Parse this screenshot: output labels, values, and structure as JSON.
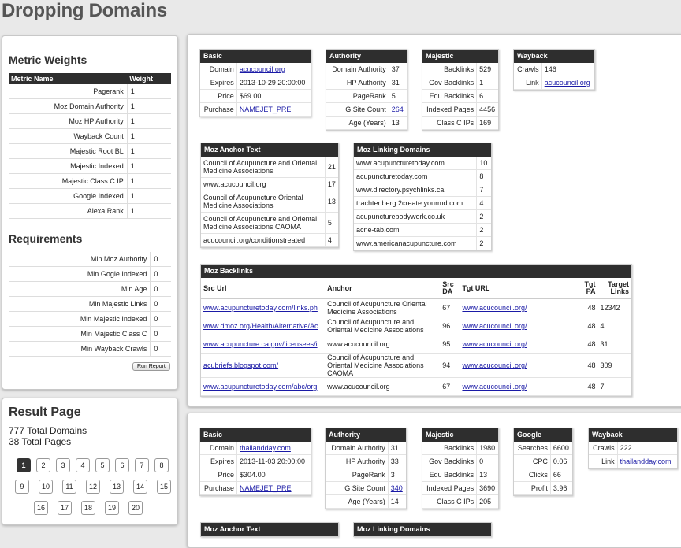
{
  "page_title": "Dropping Domains",
  "metric_weights": {
    "title": "Metric Weights",
    "col_name": "Metric Name",
    "col_weight": "Weight",
    "rows": [
      {
        "name": "Pagerank",
        "weight": "1"
      },
      {
        "name": "Moz Domain Authority",
        "weight": "1"
      },
      {
        "name": "Moz HP Authority",
        "weight": "1"
      },
      {
        "name": "Wayback Count",
        "weight": "1"
      },
      {
        "name": "Majestic Root BL",
        "weight": "1"
      },
      {
        "name": "Majestic Indexed",
        "weight": "1"
      },
      {
        "name": "Majestic Class C IP",
        "weight": "1"
      },
      {
        "name": "Google Indexed",
        "weight": "1"
      },
      {
        "name": "Alexa Rank",
        "weight": "1"
      }
    ]
  },
  "requirements": {
    "title": "Requirements",
    "rows": [
      {
        "name": "Min Moz Authority",
        "value": "0"
      },
      {
        "name": "Min Gogle Indexed",
        "value": "0"
      },
      {
        "name": "Min Age",
        "value": "0"
      },
      {
        "name": "Min Majestic Links",
        "value": "0"
      },
      {
        "name": "Min Majestic Indexed",
        "value": "0"
      },
      {
        "name": "Min Majestic Class C",
        "value": "0"
      },
      {
        "name": "Min Wayback Crawls",
        "value": "0"
      }
    ],
    "run_label": "Run Report"
  },
  "result_page": {
    "title": "Result Page",
    "total_domains": "777 Total Domains",
    "total_pages": "38 Total Pages",
    "pages": [
      "1",
      "2",
      "3",
      "4",
      "5",
      "6",
      "7",
      "8",
      "9",
      "10",
      "11",
      "12",
      "13",
      "14",
      "15",
      "16",
      "17",
      "18",
      "19",
      "20"
    ],
    "active": "1"
  },
  "results": [
    {
      "basic": {
        "title": "Basic",
        "rows": [
          [
            "Domain",
            "acucouncil.org"
          ],
          [
            "Expires",
            "2013-10-29 20:00:00"
          ],
          [
            "Price",
            "$69.00"
          ],
          [
            "Purchase",
            "NAMEJET_PRE"
          ]
        ]
      },
      "authority": {
        "title": "Authority",
        "rows": [
          [
            "Domain Authority",
            "37"
          ],
          [
            "HP Authority",
            "31"
          ],
          [
            "PageRank",
            "5"
          ],
          [
            "G Site Count",
            "264"
          ],
          [
            "Age (Years)",
            "13"
          ]
        ]
      },
      "majestic": {
        "title": "Majestic",
        "rows": [
          [
            "Backlinks",
            "529"
          ],
          [
            "Gov Backlinks",
            "1"
          ],
          [
            "Edu Backlinks",
            "6"
          ],
          [
            "Indexed Pages",
            "4456"
          ],
          [
            "Class C IPs",
            "169"
          ]
        ]
      },
      "wayback": {
        "title": "Wayback",
        "rows": [
          [
            "Crawls",
            "146"
          ],
          [
            "Link",
            "acucouncil.org"
          ]
        ]
      },
      "anchor": {
        "title": "Moz Anchor Text",
        "rows": [
          [
            "Council of Acupuncture and Oriental Medicine Associations",
            "21"
          ],
          [
            "www.acucouncil.org",
            "17"
          ],
          [
            "Council of Acupuncture Oriental Medicine Associations",
            "13"
          ],
          [
            "Council of Acupuncture and Oriental Medicine Associations CAOMA",
            "5"
          ],
          [
            "acucouncil.org/conditionstreated",
            "4"
          ]
        ]
      },
      "linking": {
        "title": "Moz Linking Domains",
        "rows": [
          [
            "www.acupuncturetoday.com",
            "10"
          ],
          [
            "acupuncturetoday.com",
            "8"
          ],
          [
            "www.directory.psychlinks.ca",
            "7"
          ],
          [
            "trachtenberg.2create.yourmd.com",
            "4"
          ],
          [
            "acupuncturebodywork.co.uk",
            "2"
          ],
          [
            "acne-tab.com",
            "2"
          ],
          [
            "www.americanacupuncture.com",
            "2"
          ]
        ]
      },
      "backlinks": {
        "title": "Moz Backlinks",
        "headers": [
          "Src Url",
          "Anchor",
          "Src DA",
          "Tgt URL",
          "Tgt PA",
          "Target Links"
        ],
        "rows": [
          [
            "www.acupuncturetoday.com/links.ph",
            "Council of Acupuncture Oriental Medicine Associations",
            "67",
            "www.acucouncil.org/",
            "48",
            "12342"
          ],
          [
            "www.dmoz.org/Health/Alternative/Ac",
            "Council of Acupuncture and Oriental Medicine Associations",
            "96",
            "www.acucouncil.org/",
            "48",
            "4"
          ],
          [
            "www.acupuncture.ca.gov/licensees/i",
            "www.acucouncil.org",
            "95",
            "www.acucouncil.org/",
            "48",
            "31"
          ],
          [
            "acubriefs.blogspot.com/",
            "Council of Acupuncture and Oriental Medicine Associations CAOMA",
            "94",
            "www.acucouncil.org/",
            "48",
            "309"
          ],
          [
            "www.acupuncturetoday.com/abc/org",
            "www.acucouncil.org",
            "67",
            "www.acucouncil.org/",
            "48",
            "7"
          ]
        ]
      }
    },
    {
      "basic": {
        "title": "Basic",
        "rows": [
          [
            "Domain",
            "thailandday.com"
          ],
          [
            "Expires",
            "2013-11-03 20:00:00"
          ],
          [
            "Price",
            "$304.00"
          ],
          [
            "Purchase",
            "NAMEJET_PRE"
          ]
        ]
      },
      "authority": {
        "title": "Authority",
        "rows": [
          [
            "Domain Authority",
            "31"
          ],
          [
            "HP Authority",
            "33"
          ],
          [
            "PageRank",
            "3"
          ],
          [
            "G Site Count",
            "340"
          ],
          [
            "Age (Years)",
            "14"
          ]
        ]
      },
      "majestic": {
        "title": "Majestic",
        "rows": [
          [
            "Backlinks",
            "1980"
          ],
          [
            "Gov Backlinks",
            "0"
          ],
          [
            "Edu Backlinks",
            "13"
          ],
          [
            "Indexed Pages",
            "3690"
          ],
          [
            "Class C IPs",
            "205"
          ]
        ]
      },
      "google": {
        "title": "Google",
        "rows": [
          [
            "Searches",
            "6600"
          ],
          [
            "CPC",
            "0.06"
          ],
          [
            "Clicks",
            "66"
          ],
          [
            "Profit",
            "3.96"
          ]
        ]
      },
      "wayback": {
        "title": "Wayback",
        "rows": [
          [
            "Crawls",
            "222"
          ],
          [
            "Link",
            "thailandday.com"
          ]
        ]
      },
      "anchor_title": "Moz Anchor Text",
      "linking_title": "Moz Linking Domains"
    }
  ]
}
